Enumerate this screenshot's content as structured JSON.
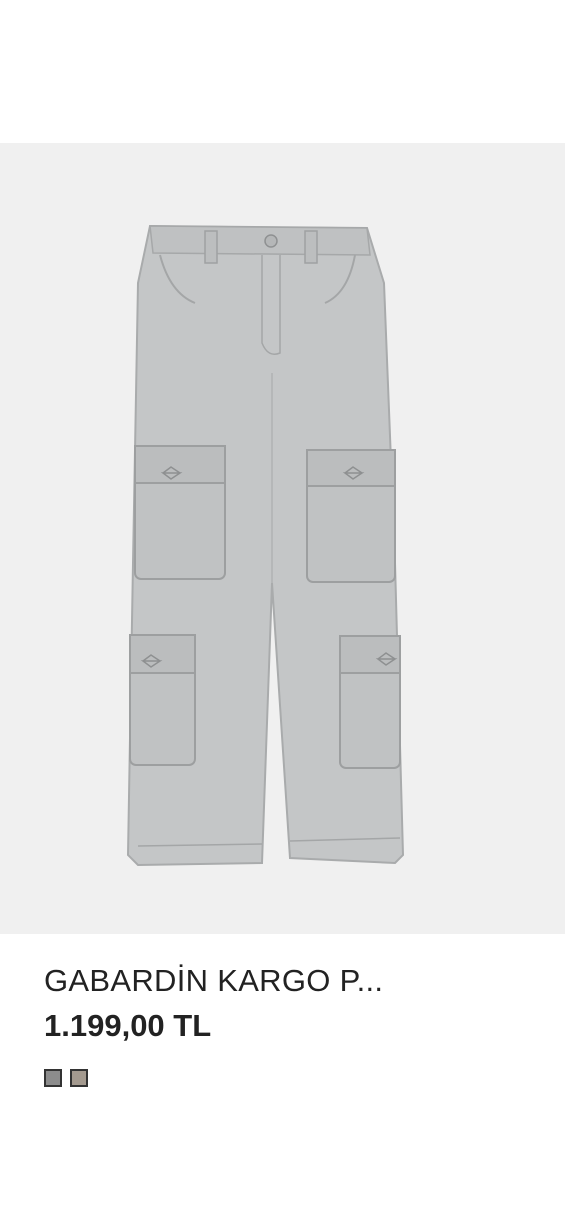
{
  "product": {
    "title": "GABARDİN KARGO P...",
    "price": "1.199,00 TL",
    "image_alt": "Light grey gabardine cargo trousers",
    "wishlist_icon": "heart-outline-icon",
    "swatches": [
      {
        "color": "#8c8c8c"
      },
      {
        "color": "#a49a8f"
      }
    ]
  },
  "colors": {
    "image_background": "#f0f0f0",
    "garment": "#c4c6c7",
    "text": "#222222"
  }
}
